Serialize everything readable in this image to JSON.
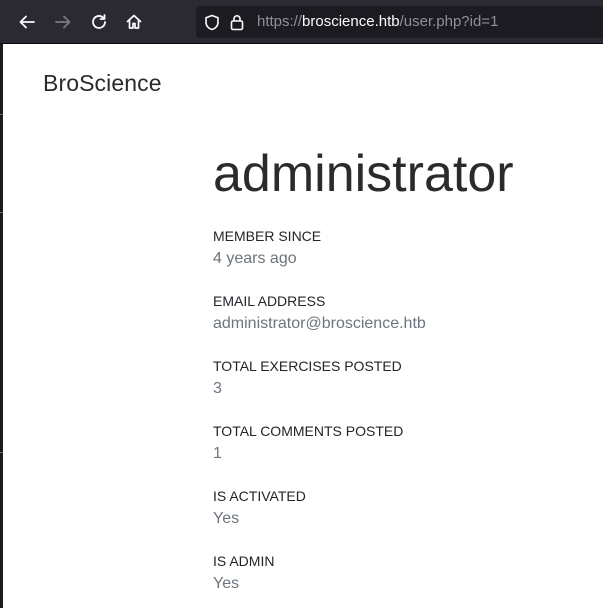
{
  "browser": {
    "url_scheme": "https://",
    "url_host": "broscience.htb",
    "url_path": "/user.php?id=1"
  },
  "site": {
    "brand": "BroScience"
  },
  "profile": {
    "username": "administrator",
    "fields": [
      {
        "label": "MEMBER SINCE",
        "value": "4 years ago"
      },
      {
        "label": "EMAIL ADDRESS",
        "value": "administrator@broscience.htb"
      },
      {
        "label": "TOTAL EXERCISES POSTED",
        "value": "3"
      },
      {
        "label": "TOTAL COMMENTS POSTED",
        "value": "1"
      },
      {
        "label": "IS ACTIVATED",
        "value": "Yes"
      },
      {
        "label": "IS ADMIN",
        "value": "Yes"
      }
    ]
  }
}
